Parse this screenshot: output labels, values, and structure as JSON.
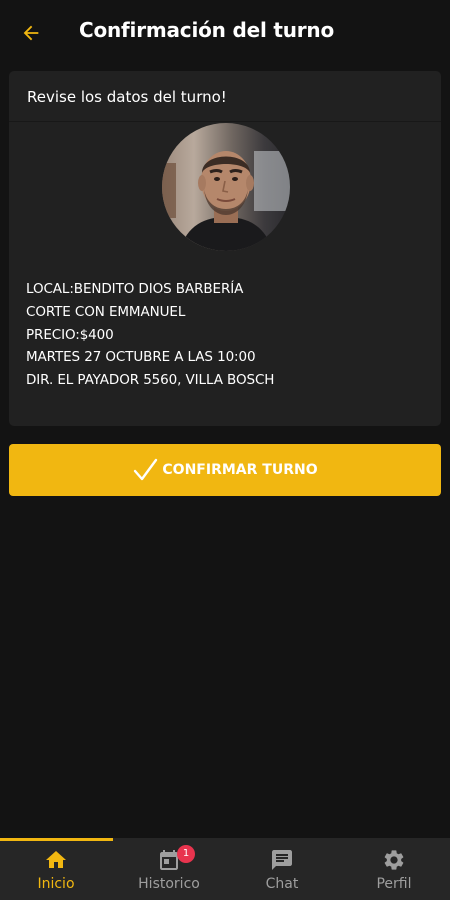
{
  "header": {
    "title": "Confirmación del turno",
    "back_icon": "arrow-left-icon",
    "accent_color": "#f1b711"
  },
  "card": {
    "header_text": "Revise los datos del turno!",
    "avatar_icon": "barber-profile-photo",
    "details": {
      "local": "LOCAL:BENDITO DIOS BARBERÍA",
      "service": "CORTE CON EMMANUEL",
      "price": "PRECIO:$400",
      "datetime": "MARTES 27 OCTUBRE A LAS 10:00",
      "address": "DIR. EL PAYADOR 5560, VILLA BOSCH"
    }
  },
  "confirm_button": {
    "label": "CONFIRMAR TURNO",
    "icon": "checkmark-icon",
    "color": "#f1b711"
  },
  "bottom_nav": {
    "items": [
      {
        "label": "Inicio",
        "icon": "home-icon",
        "active": true
      },
      {
        "label": "Historico",
        "icon": "calendar-icon",
        "badge": "1"
      },
      {
        "label": "Chat",
        "icon": "chat-icon"
      },
      {
        "label": "Perfil",
        "icon": "gear-icon"
      }
    ]
  }
}
